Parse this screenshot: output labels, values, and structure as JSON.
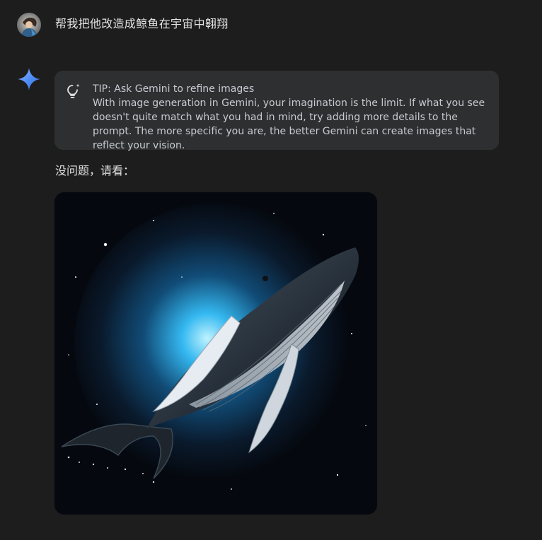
{
  "user_message": {
    "text": "帮我把他改造成鲸鱼在宇宙中翱翔"
  },
  "response": {
    "tip": {
      "title": "TIP: Ask Gemini to refine images",
      "body": "With image generation in Gemini, your imagination is the limit. If what you see doesn't quite match what you had in mind, try adding more details to the prompt. The more specific you are, the better Gemini can create images that reflect your vision."
    },
    "text": "没问题，请看："
  },
  "icons": {
    "user_avatar": "avatar-icon",
    "assistant": "gemini-sparkle-icon",
    "tip": "lightbulb-sparkle-icon"
  },
  "colors": {
    "background": "#1c1d1c",
    "tip_card": "#2d2f31",
    "text_primary": "#e3e3e3",
    "text_secondary": "#c7cbd1",
    "gemini_blue": "#4f8ef7",
    "nebula": "#34b8f0"
  }
}
